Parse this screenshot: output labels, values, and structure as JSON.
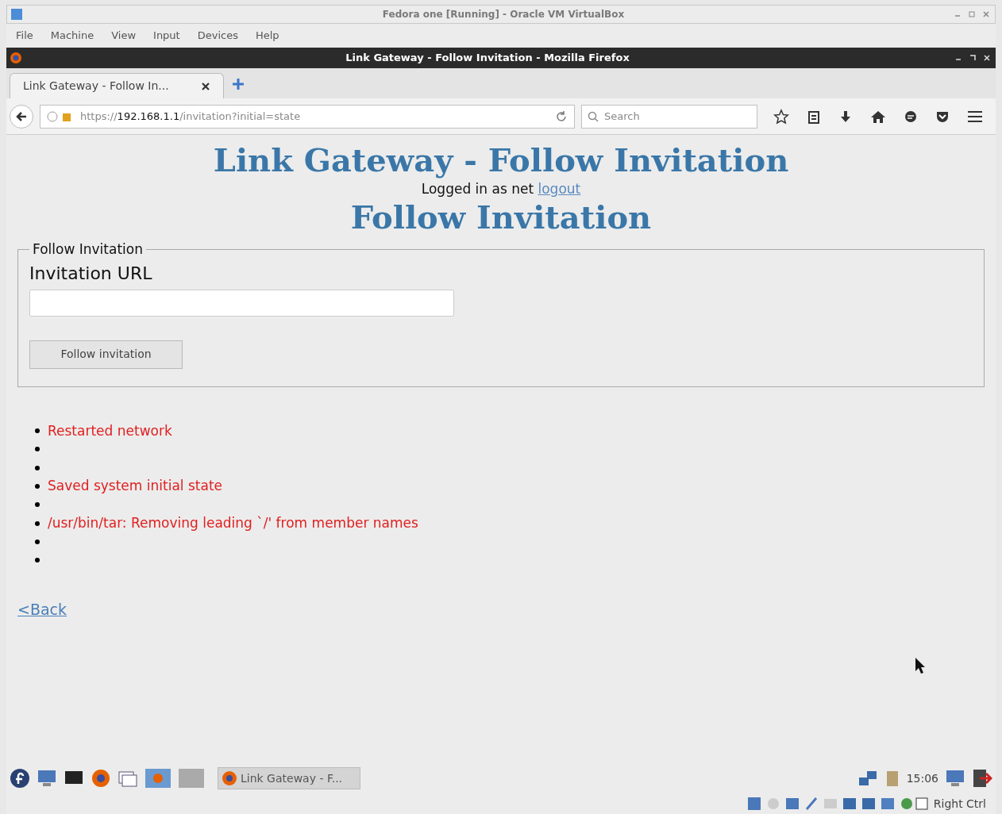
{
  "vm_window": {
    "title": "Fedora one [Running] - Oracle VM VirtualBox",
    "menu": [
      "File",
      "Machine",
      "View",
      "Input",
      "Devices",
      "Help"
    ]
  },
  "browser": {
    "title": "Link Gateway - Follow Invitation - Mozilla Firefox",
    "tabs": [
      {
        "label": "Link Gateway - Follow In...",
        "selected": true
      }
    ],
    "url": {
      "scheme": "https://",
      "host": "192.168.1.1",
      "path": "/invitation?initial=state"
    },
    "search": {
      "placeholder": "Search"
    }
  },
  "page": {
    "title": "Link Gateway - Follow Invitation",
    "login": {
      "prefix": "Logged in as net",
      "link": "logout"
    },
    "heading": "Follow Invitation",
    "form": {
      "legend": "Follow Invitation",
      "label": "Invitation URL",
      "button": "Follow invitation"
    },
    "messages": [
      {
        "kind": "text",
        "text": "Restarted network"
      },
      {
        "kind": "blank"
      },
      {
        "kind": "blank"
      },
      {
        "kind": "text",
        "text": "Saved system initial state"
      },
      {
        "kind": "blank"
      },
      {
        "kind": "text",
        "text": "/usr/bin/tar: Removing leading `/' from member names"
      },
      {
        "kind": "blank"
      },
      {
        "kind": "blank"
      }
    ],
    "back_link": "<Back"
  },
  "taskbar": {
    "task": "Link Gateway - F...",
    "clock": "15:06"
  },
  "status_bar": {
    "host_key": "Right Ctrl"
  }
}
